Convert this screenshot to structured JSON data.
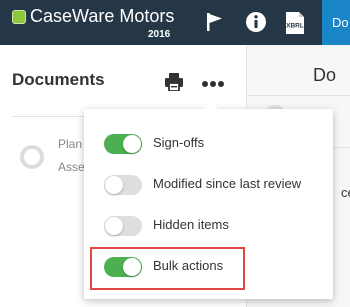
{
  "header": {
    "app_name": "CaseWare Motors",
    "year": "2016",
    "icons": [
      "flag-icon",
      "info-icon",
      "xbrl-icon"
    ],
    "xbrl_label": "XBRL",
    "right_button_label": "Do",
    "background_color": "#253746",
    "accent_color": "#1a86c8",
    "brand_color": "#8dc63f"
  },
  "documents_panel": {
    "title": "Documents",
    "icons": [
      "print-icon",
      "more-options-icon"
    ],
    "item": {
      "line1": "Plan",
      "line2": "Asse"
    }
  },
  "right_area": {
    "title_fragment": "Do",
    "text_fragment": "ce"
  },
  "options_menu": {
    "items": [
      {
        "label": "Sign-offs",
        "enabled": true
      },
      {
        "label": "Modified since last review",
        "enabled": false
      },
      {
        "label": "Hidden items",
        "enabled": false
      },
      {
        "label": "Bulk actions",
        "enabled": true
      }
    ],
    "highlighted_item": "Bulk actions",
    "toggle_on_color": "#4caf50",
    "toggle_off_color": "#dedede",
    "highlight_color": "#e04646"
  }
}
